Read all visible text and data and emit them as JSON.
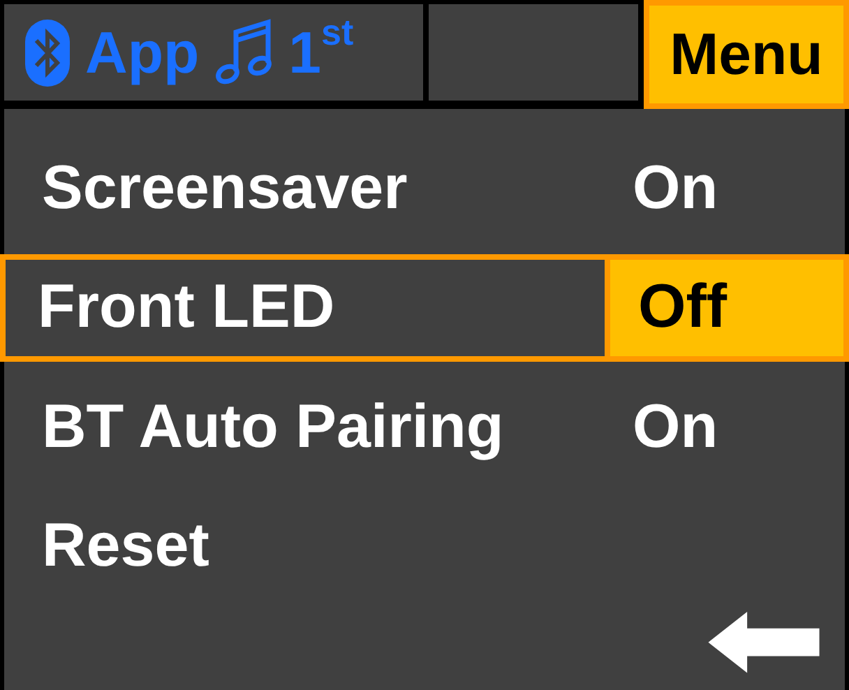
{
  "header": {
    "app": "App",
    "track": "1$^{st}$",
    "menu": {
      "label": "Menu",
      "selected": true
    }
  },
  "rows": [
    {
      "label": "Screensaver",
      "value": "On",
      "selected": false
    },
    {
      "label": "Front LED",
      "value": "Off",
      "selected": true
    },
    {
      "label": "BT Auto Pairing",
      "value": "On",
      "selected": false
    },
    {
      "label": "Reset",
      "selected": false
    }
  ]
}
